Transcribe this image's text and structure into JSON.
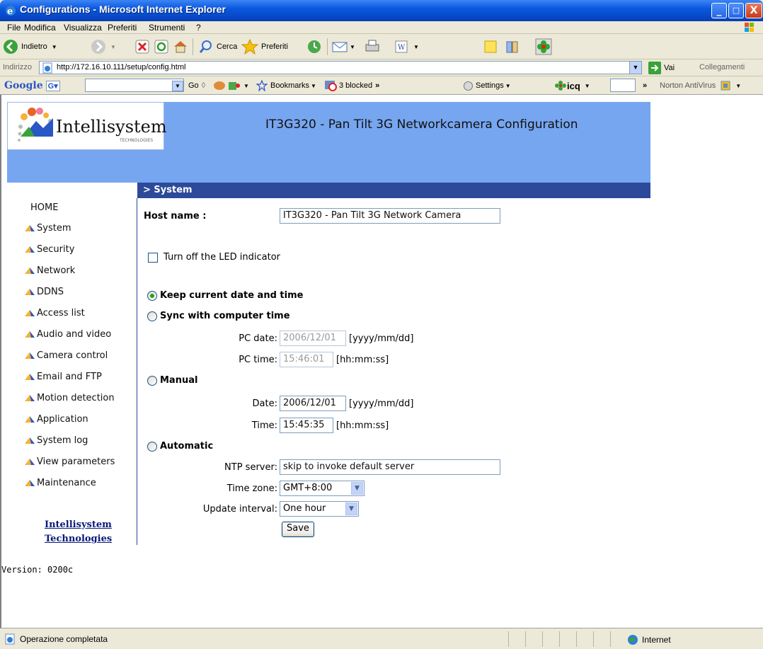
{
  "window": {
    "title": "Configurations - Microsoft Internet Explorer",
    "minimize": "_",
    "maximize": "□",
    "close": "X"
  },
  "menu": [
    "File",
    "Modifica",
    "Visualizza",
    "Preferiti",
    "Strumenti",
    "?"
  ],
  "toolbar": {
    "back": "Indietro",
    "search": "Cerca",
    "favorites": "Preferiti"
  },
  "address": {
    "label": "Indirizzo",
    "url": "http://172.16.10.111/setup/config.html",
    "go": "Vai",
    "links": "Collegamenti"
  },
  "google": {
    "logo": "Google",
    "go": "Go",
    "bookmarks": "Bookmarks",
    "blocked": "3 blocked",
    "settings": "Settings",
    "icq": "icq",
    "norton": "Norton AntiVirus"
  },
  "header": {
    "logo": "Intellisystem",
    "logo_sub": "TECHNOLOGIES",
    "title": "IT3G320 - Pan Tilt 3G Networkcamera Configuration"
  },
  "section": "> System",
  "sidebar": {
    "home": "HOME",
    "items": [
      "System",
      "Security",
      "Network",
      "DDNS",
      "Access list",
      "Audio and video",
      "Camera control",
      "Email and FTP",
      "Motion detection",
      "Application",
      "System log",
      "View parameters",
      "Maintenance"
    ],
    "company_line1": "Intellisystem",
    "company_line2": "Technologies",
    "version": "Version: 0200c"
  },
  "form": {
    "host_label": "Host name :",
    "host_value": "IT3G320 - Pan Tilt 3G Network Camera",
    "led_label": "Turn off the LED indicator",
    "keep_label": "Keep current date and time",
    "sync_label": "Sync with computer time",
    "pc_date_label": "PC date:",
    "pc_date_value": "2006/12/01",
    "pc_date_fmt": "[yyyy/mm/dd]",
    "pc_time_label": "PC time:",
    "pc_time_value": "15:46:01",
    "pc_time_fmt": "[hh:mm:ss]",
    "manual_label": "Manual",
    "date_label": "Date:",
    "date_value": "2006/12/01",
    "date_fmt": "[yyyy/mm/dd]",
    "time_label": "Time:",
    "time_value": "15:45:35",
    "time_fmt": "[hh:mm:ss]",
    "auto_label": "Automatic",
    "ntp_label": "NTP server:",
    "ntp_value": "skip to invoke default server",
    "tz_label": "Time zone:",
    "tz_value": "GMT+8:00",
    "interval_label": "Update interval:",
    "interval_value": "One hour",
    "save": "Save"
  },
  "status": {
    "text": "Operazione completata",
    "zone": "Internet"
  }
}
